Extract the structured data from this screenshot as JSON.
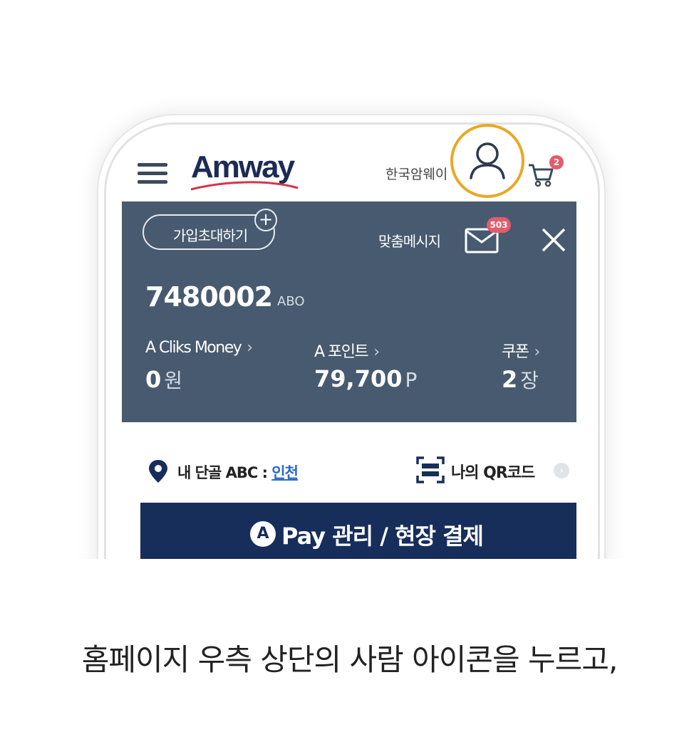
{
  "header": {
    "logo": "Amway",
    "region": "한국암웨이",
    "cart_count": "2"
  },
  "panel": {
    "invite_label": "가입초대하기",
    "message_label": "맞춤메시지",
    "message_count": "503",
    "member_id": "7480002",
    "member_type": "ABO",
    "stats": [
      {
        "label": "A Cliks Money",
        "value": "0",
        "unit": "원"
      },
      {
        "label": "A 포인트",
        "value": "79,700",
        "unit": "P"
      },
      {
        "label": "쿠폰",
        "value": "2",
        "unit": "장"
      }
    ]
  },
  "store": {
    "prefix": "내 단골 ABC : ",
    "name": "인천"
  },
  "qr": {
    "label": "나의 QR코드"
  },
  "pay": {
    "logo_letter": "A",
    "label": "Pay 관리 / 현장 결제"
  },
  "caption": "홈페이지 우측 상단의 사람 아이콘을 누르고,",
  "colors": {
    "highlight": "#e9a825",
    "panel": "#475a6f",
    "pay_button": "#172e5b",
    "badge": "#e45b6b"
  }
}
